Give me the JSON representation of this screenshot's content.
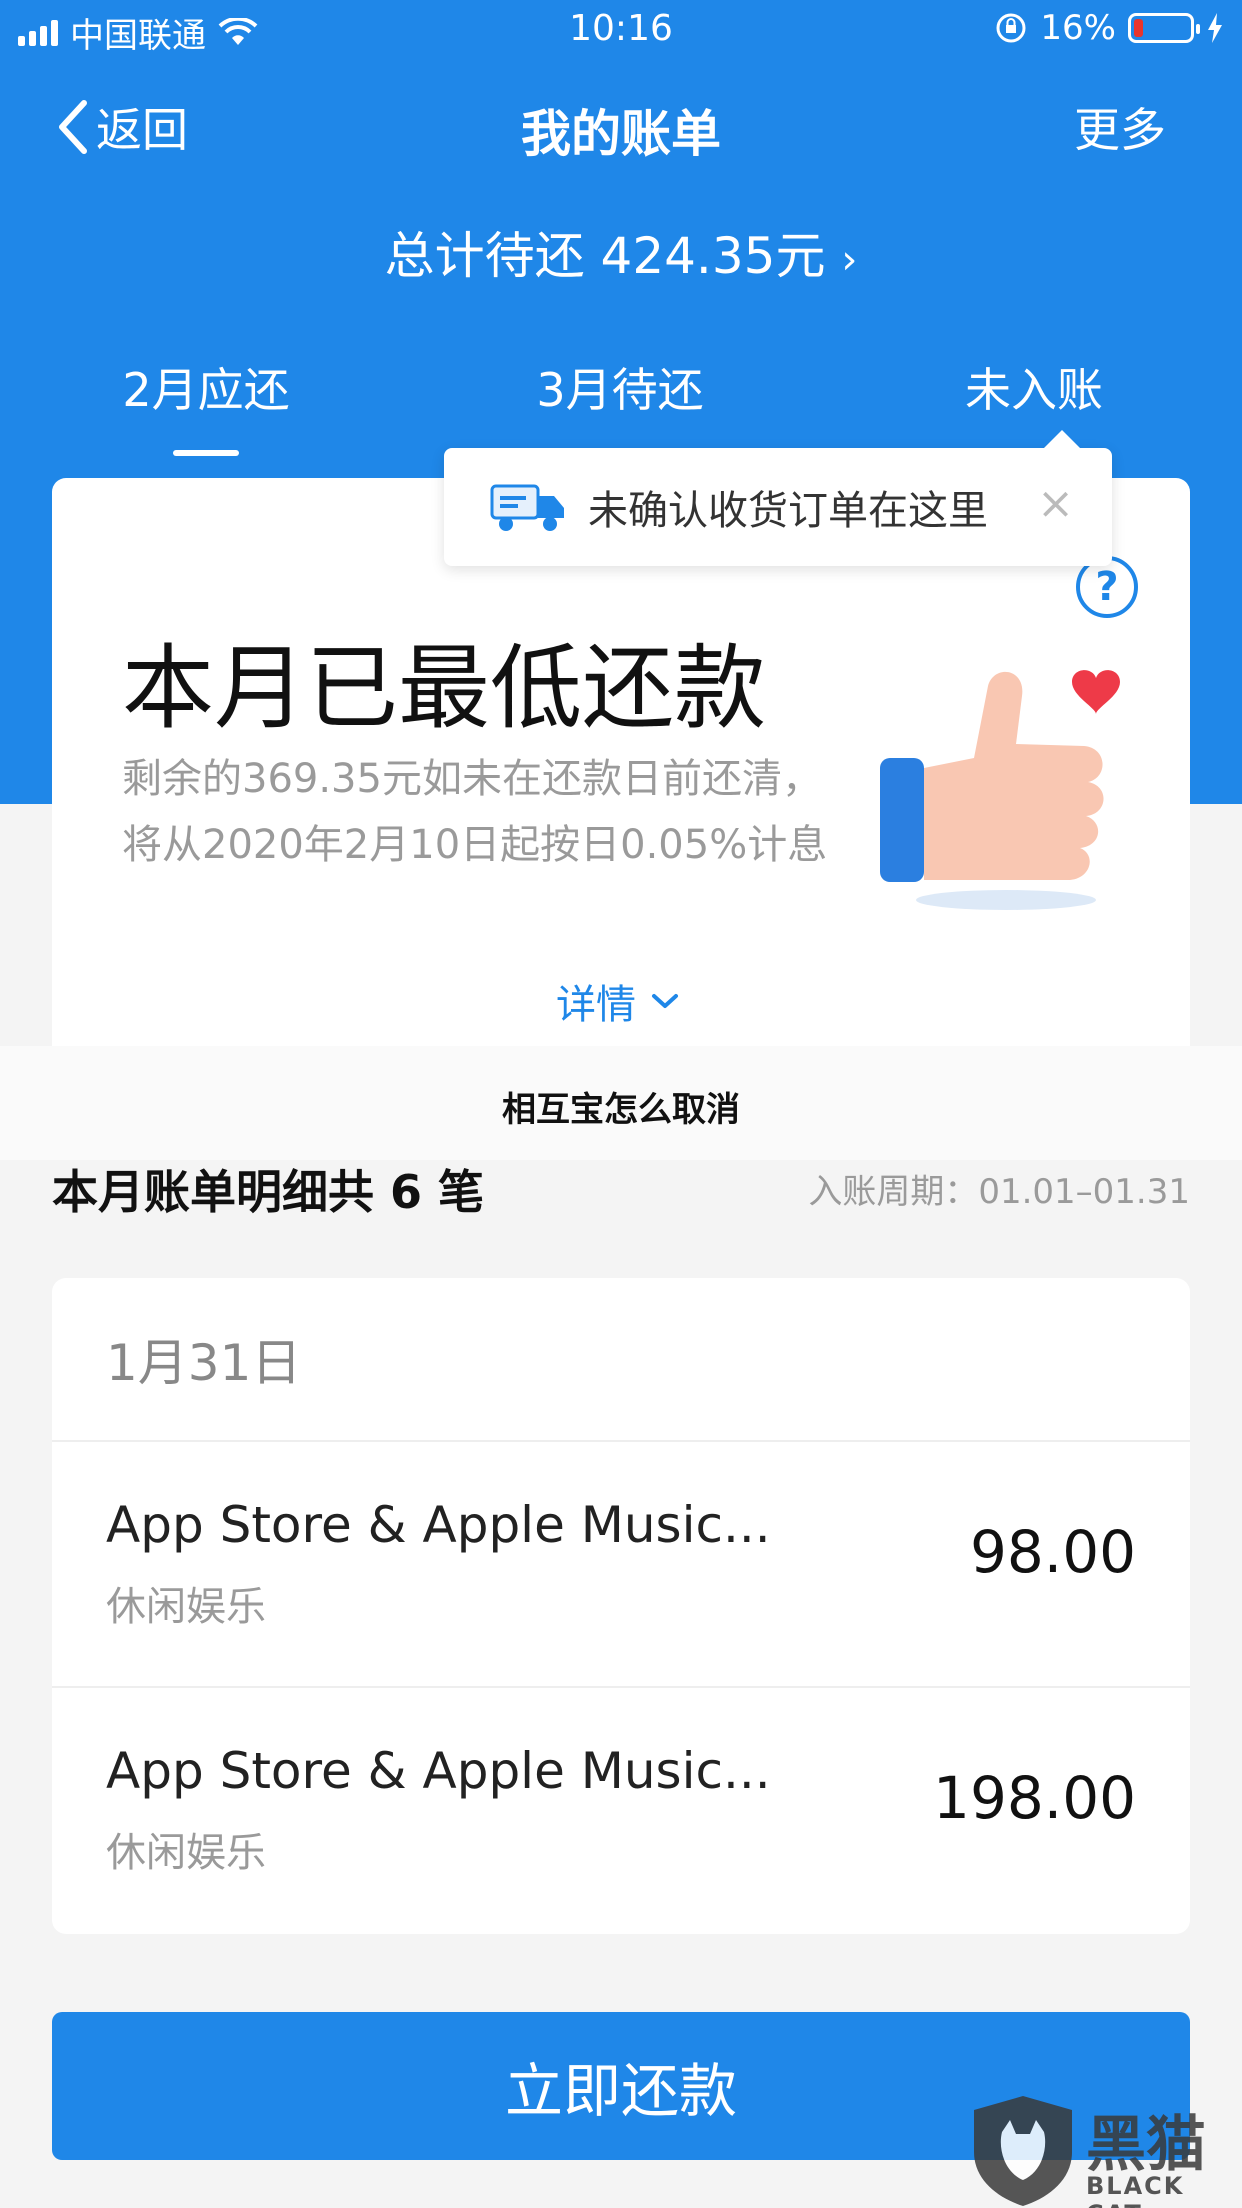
{
  "status_bar": {
    "carrier": "中国联通",
    "time": "10:16",
    "battery": "16%",
    "battery_level": 0.16,
    "icons": [
      "signal-icon",
      "wifi-icon",
      "rotation-lock-icon",
      "battery-icon",
      "charging-icon"
    ]
  },
  "nav": {
    "back_label": "返回",
    "title": "我的账单",
    "more_label": "更多"
  },
  "total": "总计待还 424.35元",
  "tabs": [
    {
      "label": "2月应还",
      "active": true
    },
    {
      "label": "3月待还",
      "active": false
    },
    {
      "label": "未入账",
      "active": false
    }
  ],
  "tooltip": {
    "text": "未确认收货订单在这里",
    "close": "×"
  },
  "summary": {
    "title": "本月已最低还款",
    "description": "剩余的369.35元如未在还款日前还清，将从2020年2月10日起按日0.05%计息",
    "detail_label": "详情"
  },
  "banner": "相互宝怎么取消",
  "bill": {
    "section_title": "本月账单明细共 6 笔",
    "period": "入账周期：01.01–01.31",
    "date": "1月31日",
    "items": [
      {
        "name": "App Store & Apple Music...",
        "category": "休闲娱乐",
        "amount": "98.00"
      },
      {
        "name": "App Store & Apple Music...",
        "category": "休闲娱乐",
        "amount": "198.00"
      }
    ]
  },
  "pay_button": "立即还款",
  "watermark": {
    "cn": "黑猫",
    "en": "BLACK CAT"
  },
  "colors": {
    "primary": "#1f87e8",
    "background": "#f4f4f4",
    "battery_low": "#e8342c"
  }
}
